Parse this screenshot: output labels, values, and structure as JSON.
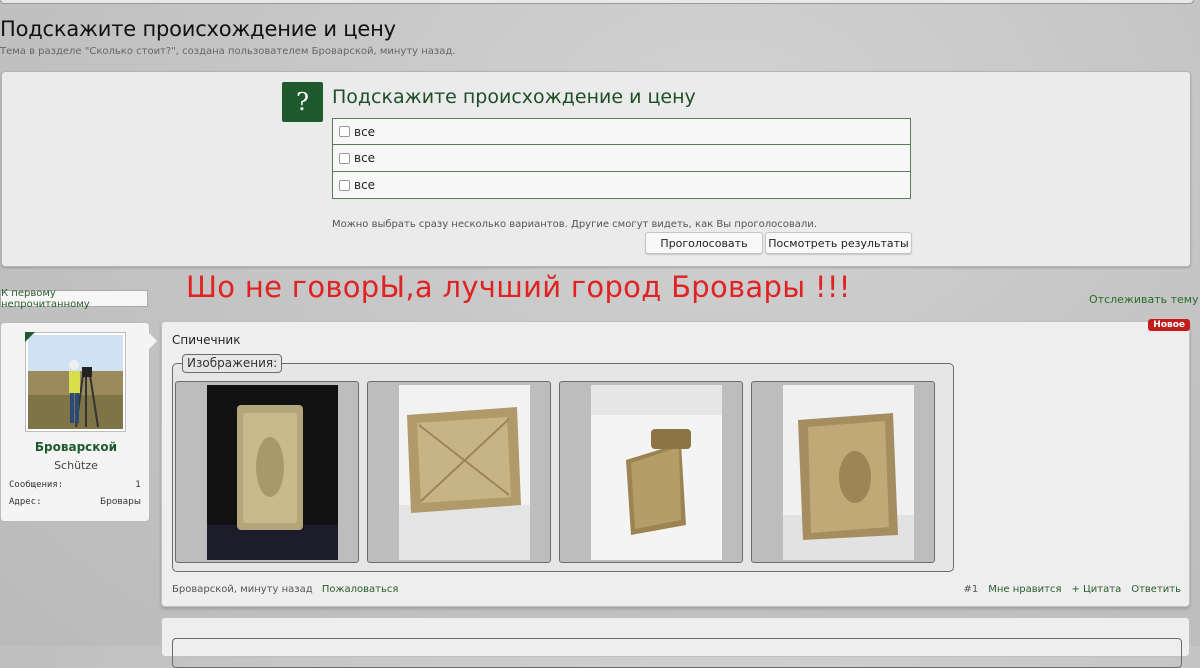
{
  "thread": {
    "title": "Подскажите происхождение и цену",
    "description": "Тема в разделе \"Сколько стоит?\", создана пользователем Броварской, минуту назад."
  },
  "poll": {
    "icon": "?",
    "question": "Подскажите происхождение и цену",
    "options": [
      {
        "label": "все",
        "checked": false
      },
      {
        "label": "все",
        "checked": false
      },
      {
        "label": "все",
        "checked": false
      }
    ],
    "note": "Можно выбрать сразу несколько вариантов. Другие смогут видеть, как Вы проголосовали.",
    "vote_label": "Проголосовать",
    "results_label": "Посмотреть результаты"
  },
  "nav": {
    "first_unread": "К первому непрочитанному",
    "watch_thread": "Отслеживать тему"
  },
  "slogan": "Шо не говорЫ,а лучший город Бровары !!!",
  "user": {
    "name": "Броварской",
    "title": "Schütze",
    "stats": [
      {
        "label": "Сообщения:",
        "value": "1"
      },
      {
        "label": "Адрес:",
        "value": "Бровары"
      }
    ]
  },
  "post": {
    "badge": "Новое",
    "text": "Спичечник",
    "images_legend": "Изображения:",
    "author_time": "Броварской, минуту назад",
    "report": "Пожаловаться",
    "number": "#1",
    "like": "Мне нравится",
    "quote": "+ Цитата",
    "reply": "Ответить"
  },
  "colors": {
    "accent": "#1f5a2e",
    "slogan": "#e02222",
    "badge": "#c21d1d"
  }
}
